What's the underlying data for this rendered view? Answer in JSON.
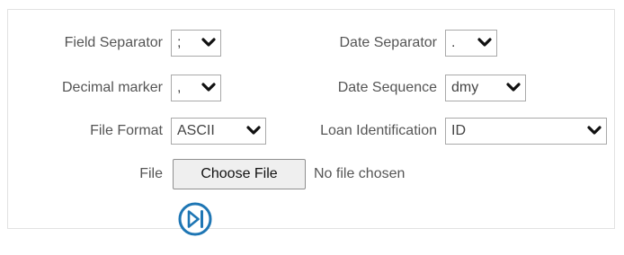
{
  "form": {
    "field_separator": {
      "label": "Field Separator",
      "value": ";"
    },
    "date_separator": {
      "label": "Date Separator",
      "value": "."
    },
    "decimal_marker": {
      "label": "Decimal marker",
      "value": ","
    },
    "date_sequence": {
      "label": "Date Sequence",
      "value": "dmy"
    },
    "file_format": {
      "label": "File Format",
      "value": "ASCII"
    },
    "loan_identification": {
      "label": "Loan Identification",
      "value": "ID"
    },
    "file": {
      "label": "File",
      "button_label": "Choose File",
      "status": "No file chosen"
    },
    "run_button": {
      "icon": "skip-next-icon",
      "color": "#1e76b4"
    }
  },
  "colors": {
    "accent": "#1e76b4",
    "border": "#a9a9a9",
    "panel_border": "#e2e2e2"
  }
}
